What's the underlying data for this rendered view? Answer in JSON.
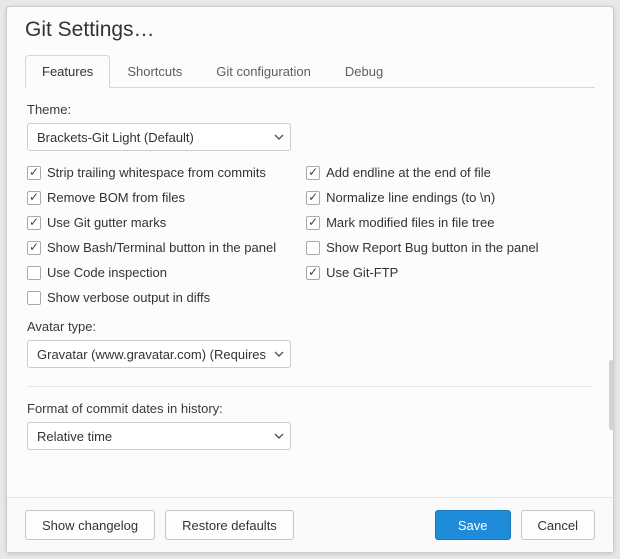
{
  "dialog": {
    "title": "Git Settings…"
  },
  "tabs": {
    "features": "Features",
    "shortcuts": "Shortcuts",
    "gitconfig": "Git configuration",
    "debug": "Debug"
  },
  "theme": {
    "label": "Theme:",
    "value": "Brackets-Git Light (Default)"
  },
  "checks_left": [
    {
      "label": "Strip trailing whitespace from commits",
      "checked": true
    },
    {
      "label": "Remove BOM from files",
      "checked": true
    },
    {
      "label": "Use Git gutter marks",
      "checked": true
    },
    {
      "label": "Show Bash/Terminal button in the panel",
      "checked": true
    },
    {
      "label": "Use Code inspection",
      "checked": false
    },
    {
      "label": "Show verbose output in diffs",
      "checked": false
    }
  ],
  "checks_right": [
    {
      "label": "Add endline at the end of file",
      "checked": true
    },
    {
      "label": "Normalize line endings (to \\n)",
      "checked": true
    },
    {
      "label": "Mark modified files in file tree",
      "checked": true
    },
    {
      "label": "Show Report Bug button in the panel",
      "checked": false
    },
    {
      "label": "Use Git-FTP",
      "checked": true
    }
  ],
  "avatar": {
    "label": "Avatar type:",
    "value": "Gravatar (www.gravatar.com) (Requires internet connection)"
  },
  "dateformat": {
    "label": "Format of commit dates in history:",
    "value": "Relative time"
  },
  "footer": {
    "changelog": "Show changelog",
    "restore": "Restore defaults",
    "save": "Save",
    "cancel": "Cancel"
  }
}
